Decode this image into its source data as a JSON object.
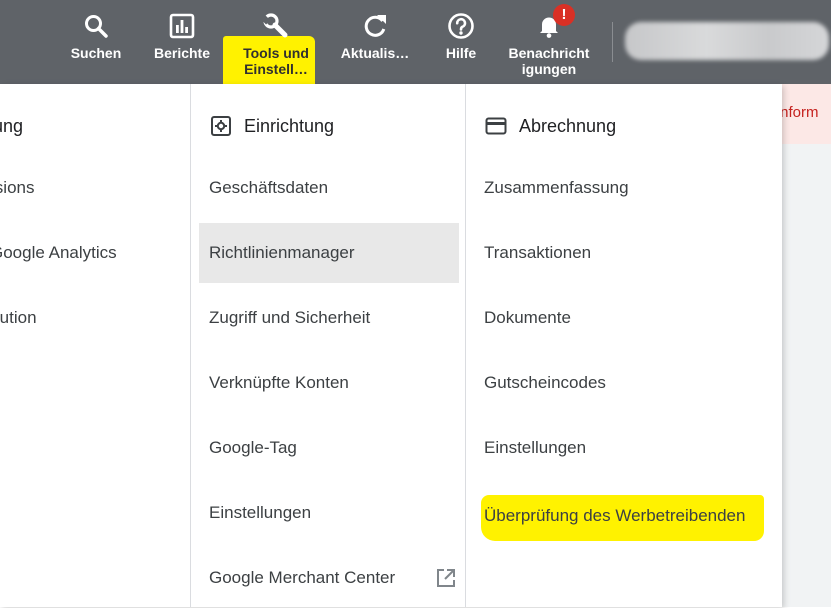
{
  "topbar": {
    "buttons": [
      {
        "id": "search",
        "label": "Suchen",
        "icon": "search-icon"
      },
      {
        "id": "reports",
        "label": "Berichte",
        "icon": "bar-chart-icon"
      },
      {
        "id": "tools",
        "label_line1": "Tools und",
        "label_line2": "Einstell…",
        "icon": "wrench-icon",
        "highlighted": true
      },
      {
        "id": "refresh",
        "label": "Aktualis…",
        "icon": "refresh-icon"
      },
      {
        "id": "help",
        "label": "Hilfe",
        "icon": "help-icon"
      },
      {
        "id": "notifications",
        "label_line1": "Benachricht",
        "label_line2": "igungen",
        "icon": "bell-icon",
        "badge": "!"
      }
    ]
  },
  "menu": {
    "col1": {
      "header": "Messung",
      "items": [
        "Conversions",
        "Google Analytics",
        "Attribution"
      ]
    },
    "col2": {
      "header": "Einrichtung",
      "header_icon": "gear-icon",
      "items": [
        "Geschäftsdaten",
        "Richtlinienmanager",
        "Zugriff und Sicherheit",
        "Verknüpfte Konten",
        "Google-Tag",
        "Einstellungen",
        "Google Merchant Center"
      ],
      "active_index": 1
    },
    "col3": {
      "header": "Abrechnung",
      "header_icon": "credit-card-icon",
      "items": [
        "Zusammenfassung",
        "Transaktionen",
        "Dokumente",
        "Gutscheincodes",
        "Einstellungen",
        "Überprüfung des Werbetreibenden"
      ],
      "highlighted_index": 5
    }
  },
  "page": {
    "alert_fragment": "Inform"
  },
  "colors": {
    "topbar_bg": "#5f6368",
    "highlight": "#fff200",
    "badge": "#d93025",
    "active_item_bg": "#e8e8e8"
  }
}
